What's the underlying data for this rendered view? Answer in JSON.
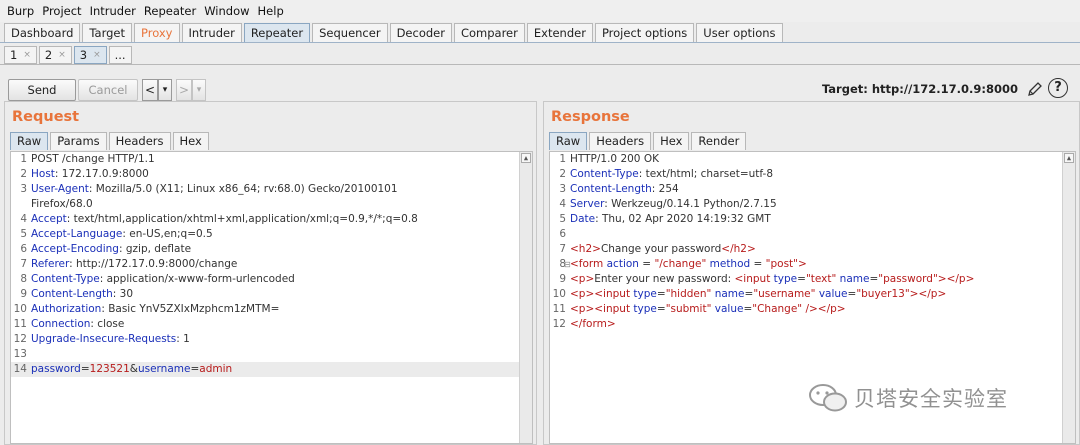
{
  "menu": [
    "Burp",
    "Project",
    "Intruder",
    "Repeater",
    "Window",
    "Help"
  ],
  "tabs": [
    "Dashboard",
    "Target",
    "Proxy",
    "Intruder",
    "Repeater",
    "Sequencer",
    "Decoder",
    "Comparer",
    "Extender",
    "Project options",
    "User options"
  ],
  "repeater_tabs": [
    "1",
    "2",
    "3",
    "..."
  ],
  "toolbar": {
    "send": "Send",
    "cancel": "Cancel",
    "back": "<",
    "forward": ">",
    "dropdown": "▾",
    "target": "Target: http://172.17.0.9:8000",
    "help": "?"
  },
  "request": {
    "title": "Request",
    "tabs": [
      "Raw",
      "Params",
      "Headers",
      "Hex"
    ],
    "lines": [
      {
        "n": "1",
        "plain": "POST /change HTTP/1.1"
      },
      {
        "n": "2",
        "key": "Host",
        "val": ": 172.17.0.9:8000"
      },
      {
        "n": "3",
        "key": "User-Agent",
        "val": ": Mozilla/5.0 (X11; Linux x86_64; rv:68.0) Gecko/20100101"
      },
      {
        "n": "",
        "plain": "Firefox/68.0"
      },
      {
        "n": "4",
        "key": "Accept",
        "val": ": text/html,application/xhtml+xml,application/xml;q=0.9,*/*;q=0.8"
      },
      {
        "n": "5",
        "key": "Accept-Language",
        "val": ": en-US,en;q=0.5"
      },
      {
        "n": "6",
        "key": "Accept-Encoding",
        "val": ": gzip, deflate"
      },
      {
        "n": "7",
        "key": "Referer",
        "val": ": http://172.17.0.9:8000/change"
      },
      {
        "n": "8",
        "key": "Content-Type",
        "val": ": application/x-www-form-urlencoded"
      },
      {
        "n": "9",
        "key": "Content-Length",
        "val": ": 30"
      },
      {
        "n": "10",
        "key": "Authorization",
        "val": ": Basic YnV5ZXIxMzphcm1zMTM="
      },
      {
        "n": "11",
        "key": "Connection",
        "val": ": close"
      },
      {
        "n": "12",
        "key": "Upgrade-Insecure-Requests",
        "val": ": 1"
      },
      {
        "n": "13",
        "plain": ""
      },
      {
        "n": "14",
        "body": true,
        "k1": "password",
        "v1": "123521",
        "amp": "&",
        "k2": "username",
        "v2": "admin",
        "eq": "="
      }
    ]
  },
  "response": {
    "title": "Response",
    "tabs": [
      "Raw",
      "Headers",
      "Hex",
      "Render"
    ],
    "lines": [
      {
        "n": "1",
        "plain": "HTTP/1.0 200 OK"
      },
      {
        "n": "2",
        "key": "Content-Type",
        "val": ": text/html; charset=utf-8"
      },
      {
        "n": "3",
        "key": "Content-Length",
        "val": ": 254"
      },
      {
        "n": "4",
        "key": "Server",
        "val": ": Werkzeug/0.14.1 Python/2.7.15"
      },
      {
        "n": "5",
        "key": "Date",
        "val": ": Thu, 02 Apr 2020 14:19:32 GMT"
      },
      {
        "n": "6",
        "plain": ""
      },
      {
        "n": "7",
        "html": [
          [
            "t",
            "<h2>"
          ],
          [
            "p",
            "Change your password"
          ],
          [
            "t",
            "</h2>"
          ]
        ]
      },
      {
        "n": "8",
        "fold": true,
        "html": [
          [
            "t",
            "<form "
          ],
          [
            "a",
            "action"
          ],
          [
            "p",
            " = "
          ],
          [
            "v",
            "\"/change\""
          ],
          [
            "p",
            " "
          ],
          [
            "a",
            "method"
          ],
          [
            "p",
            " = "
          ],
          [
            "v",
            "\"post\""
          ],
          [
            "t",
            ">"
          ]
        ]
      },
      {
        "n": "9",
        "html": [
          [
            "t",
            "<p>"
          ],
          [
            "p",
            "Enter your new password: "
          ],
          [
            "t",
            "<input "
          ],
          [
            "a",
            "type"
          ],
          [
            "p",
            "="
          ],
          [
            "v",
            "\"text\""
          ],
          [
            "p",
            " "
          ],
          [
            "a",
            "name"
          ],
          [
            "p",
            "="
          ],
          [
            "v",
            "\"password\""
          ],
          [
            "t",
            "></p>"
          ]
        ]
      },
      {
        "n": "10",
        "html": [
          [
            "t",
            "<p><input "
          ],
          [
            "a",
            "type"
          ],
          [
            "p",
            "="
          ],
          [
            "v",
            "\"hidden\""
          ],
          [
            "p",
            " "
          ],
          [
            "a",
            "name"
          ],
          [
            "p",
            "="
          ],
          [
            "v",
            "\"username\""
          ],
          [
            "p",
            " "
          ],
          [
            "a",
            "value"
          ],
          [
            "p",
            "="
          ],
          [
            "v",
            "\"buyer13\""
          ],
          [
            "t",
            "></p>"
          ]
        ]
      },
      {
        "n": "11",
        "html": [
          [
            "t",
            "<p><input "
          ],
          [
            "a",
            "type"
          ],
          [
            "p",
            "="
          ],
          [
            "v",
            "\"submit\""
          ],
          [
            "p",
            " "
          ],
          [
            "a",
            "value"
          ],
          [
            "p",
            "="
          ],
          [
            "v",
            "\"Change\""
          ],
          [
            "p",
            " "
          ],
          [
            "t",
            "/></p>"
          ]
        ]
      },
      {
        "n": "12",
        "html": [
          [
            "t",
            "</form>"
          ]
        ]
      }
    ]
  },
  "watermark": "贝塔安全实验室",
  "colors": {
    "accent": "#e8743b",
    "header_key": "#1a2fb8",
    "value": "#b71b1b"
  }
}
